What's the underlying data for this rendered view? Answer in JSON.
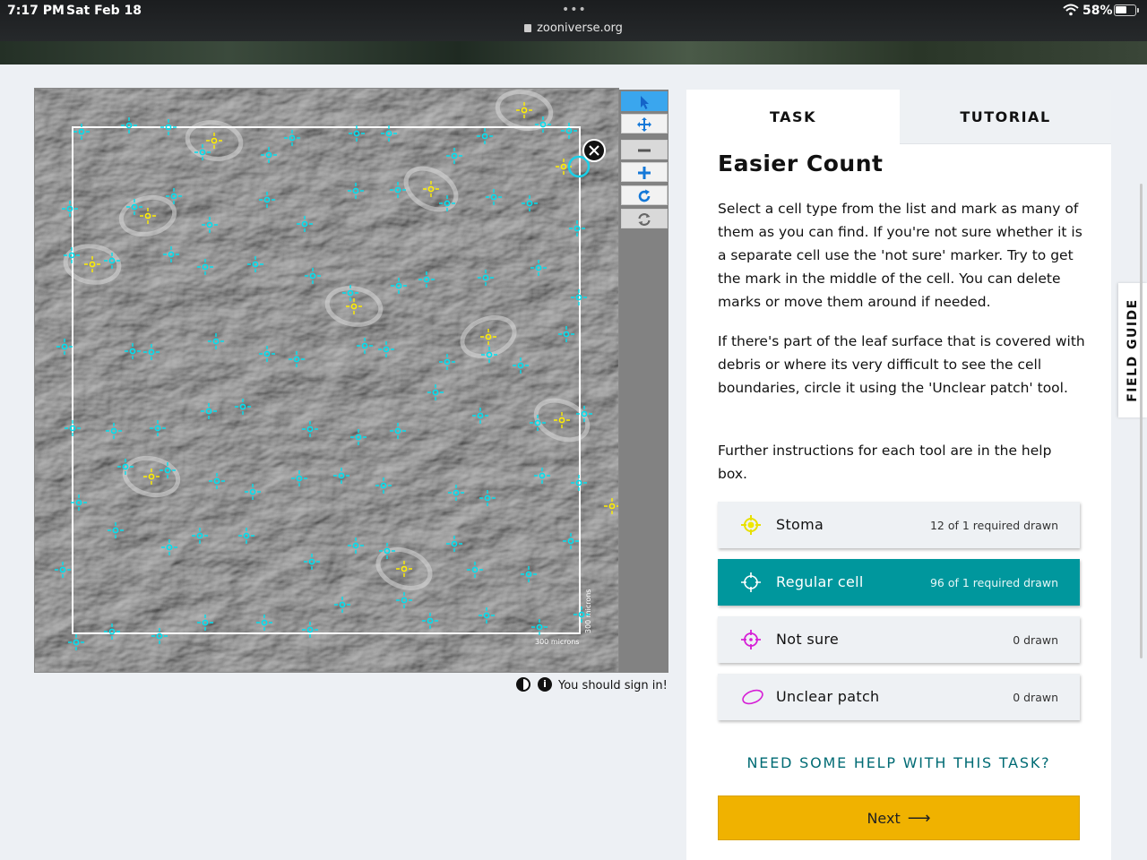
{
  "status_bar": {
    "time": "7:17 PM",
    "date": "Sat Feb 18",
    "url": "zooniverse.org",
    "battery": "58%",
    "battery_level": 0.58
  },
  "subject": {
    "scale_horizontal": "300 microns",
    "scale_vertical": "300 microns",
    "marks": {
      "regular_color": "#00e0f0",
      "stoma_color": "#ffee00",
      "regular_count": 96,
      "stoma_count": 12
    }
  },
  "viewer_toolbar": {
    "buttons": [
      {
        "name": "annotate",
        "icon": "pointer-arrow-icon",
        "active": true
      },
      {
        "name": "pan",
        "icon": "move-arrows-icon",
        "active": false
      },
      {
        "name": "zoom-out",
        "icon": "minus-icon",
        "active": false
      },
      {
        "name": "zoom-in",
        "icon": "plus-icon",
        "active": false
      },
      {
        "name": "rotate",
        "icon": "rotate-icon",
        "active": false
      },
      {
        "name": "reset",
        "icon": "refresh-icon",
        "active": false
      }
    ]
  },
  "meta": {
    "sign_in": "You should sign in!"
  },
  "tabs": {
    "task": "TASK",
    "tutorial": "TUTORIAL"
  },
  "task": {
    "title": "Easier Count",
    "paragraph_1": "Select a cell type from the list and mark as many of them as you can find. If you're not sure whether it is a separate cell use the 'not sure' marker. Try to get the mark in the middle of the cell. You can delete marks or move them around if needed.",
    "paragraph_2": "If there's part of the leaf surface that is covered with debris or where its very difficult to see the cell boundaries, circle it using the 'Unclear patch' tool.",
    "paragraph_3": "Further instructions for each tool are in the help box.",
    "tools": [
      {
        "label": "Stoma",
        "count": "12 of 1 required drawn",
        "color": "#e8e000",
        "icon": "crosshair-icon",
        "selected": false
      },
      {
        "label": "Regular cell",
        "count": "96 of 1 required drawn",
        "color": "#ffffff",
        "icon": "crosshair-icon",
        "selected": true
      },
      {
        "label": "Not sure",
        "count": "0 drawn",
        "color": "#d61fd6",
        "icon": "crosshair-icon",
        "selected": false
      },
      {
        "label": "Unclear patch",
        "count": "0 drawn",
        "color": "#d61fd6",
        "icon": "ellipse-icon",
        "selected": false
      }
    ],
    "help_link": "NEED SOME HELP WITH THIS TASK?",
    "next_label": "Next",
    "next_color": "#f0b200"
  },
  "field_guide": "FIELD GUIDE"
}
